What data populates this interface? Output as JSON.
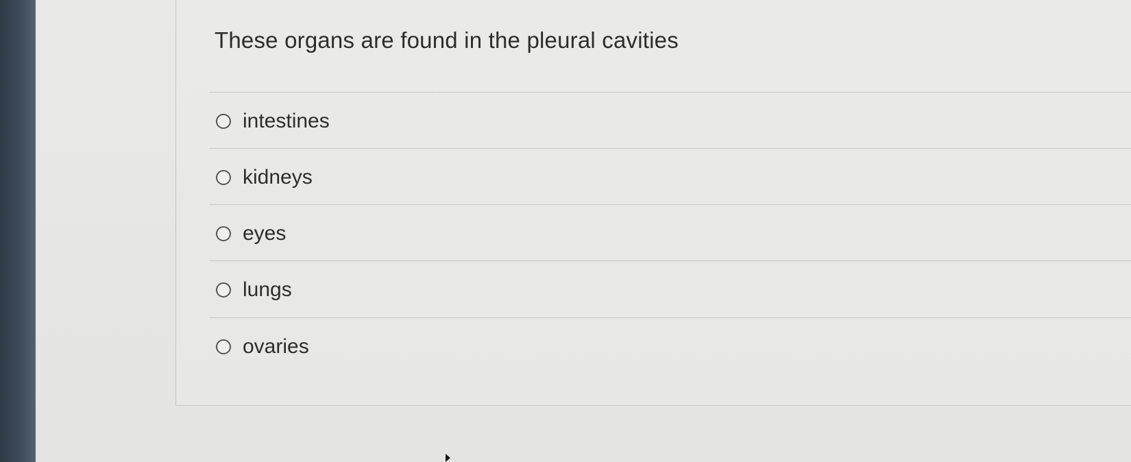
{
  "question": {
    "text": "These organs are found in the pleural cavities"
  },
  "options": [
    {
      "label": "intestines",
      "selected": false,
      "icon": "radio-unchecked-icon"
    },
    {
      "label": "kidneys",
      "selected": false,
      "icon": "radio-unchecked-icon"
    },
    {
      "label": "eyes",
      "selected": false,
      "icon": "radio-unchecked-icon"
    },
    {
      "label": "lungs",
      "selected": false,
      "icon": "radio-unchecked-icon"
    },
    {
      "label": "ovaries",
      "selected": false,
      "icon": "radio-unchecked-icon"
    }
  ],
  "colors": {
    "text": "#2d2d2d",
    "background": "#e8e8e6",
    "divider": "#c6c6c4",
    "radio_border": "#555555",
    "bezel": "#3d4a59"
  }
}
